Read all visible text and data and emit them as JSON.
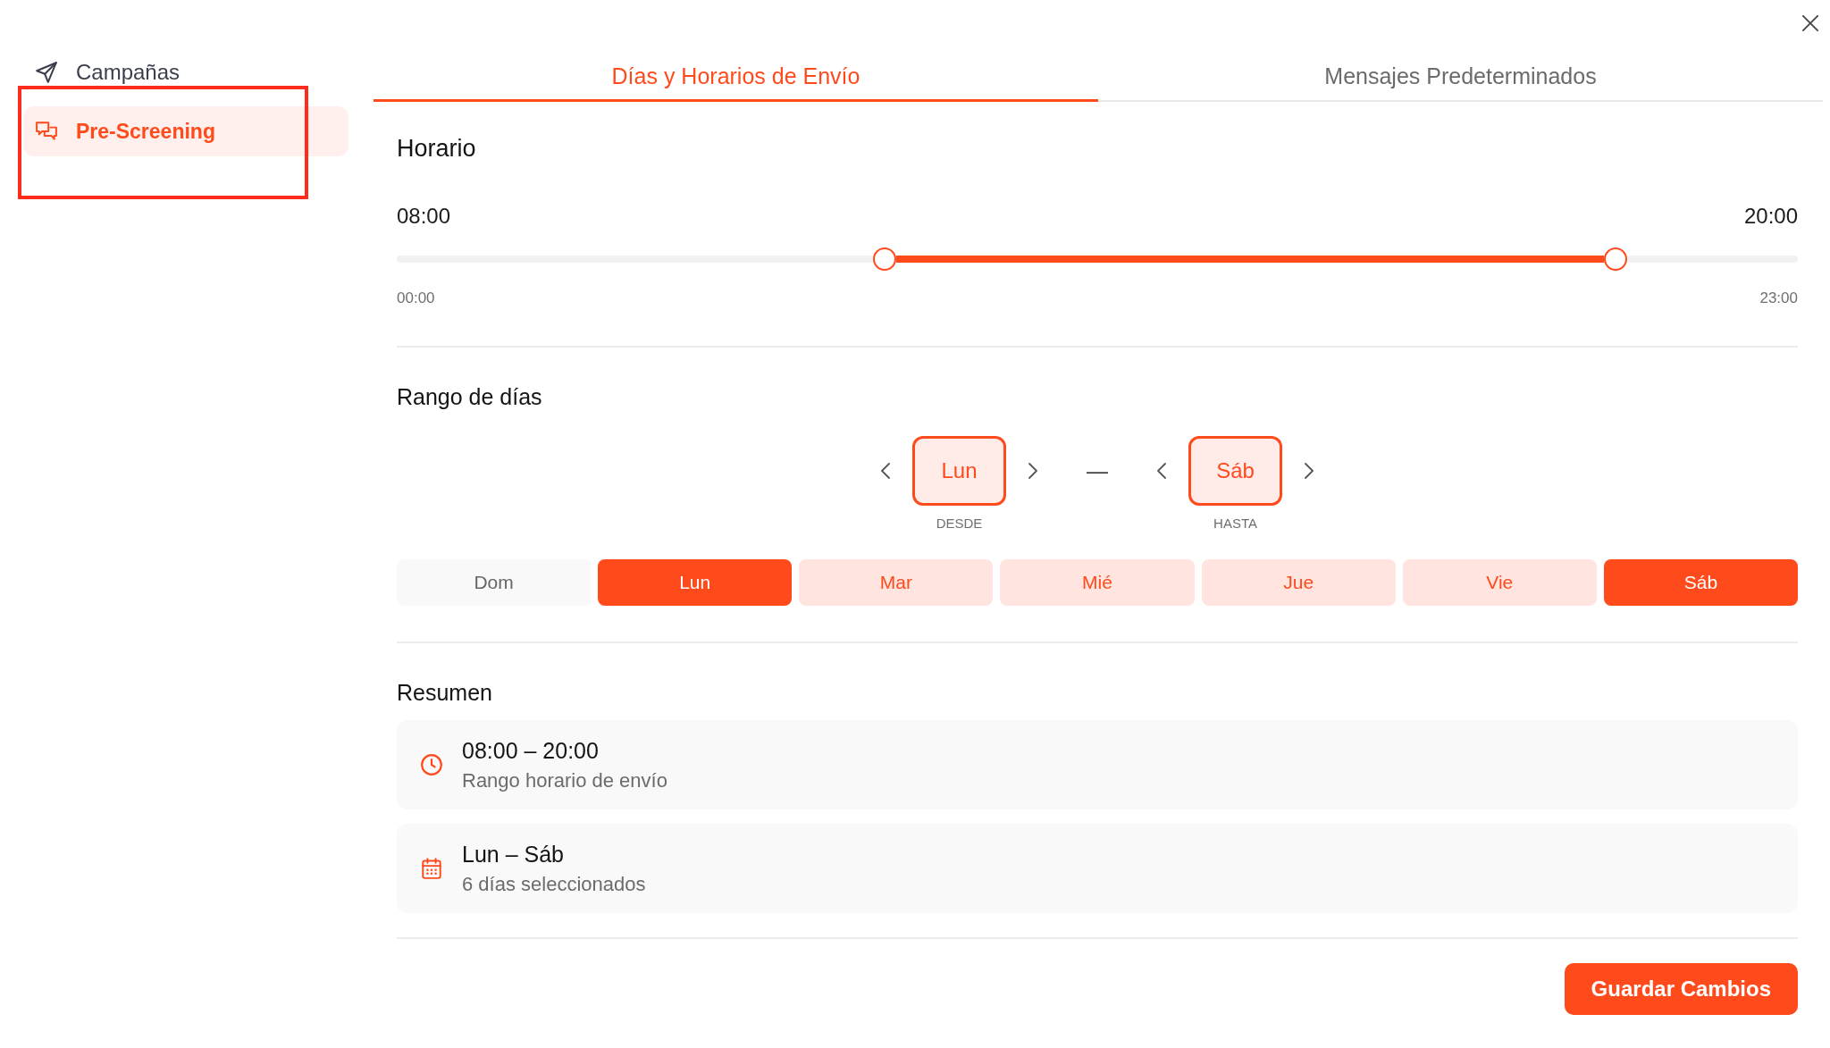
{
  "sidebar": {
    "items": [
      {
        "label": "Campañas",
        "selected": false,
        "highlighted": false
      },
      {
        "label": "Pre-Screening",
        "selected": true,
        "highlighted": true
      }
    ]
  },
  "tabs": [
    {
      "label": "Días y Horarios de Envío",
      "selected": true
    },
    {
      "label": "Mensajes Predeterminados",
      "selected": false
    }
  ],
  "schedule": {
    "title": "Horario",
    "start_time": "08:00",
    "end_time": "20:00",
    "slider": {
      "thumbs": [
        {
          "level": 0.348
        },
        {
          "level": 0.87
        }
      ],
      "min_label": "00:00",
      "max_label": "23:00"
    }
  },
  "day_range": {
    "title": "Rango de días",
    "from": {
      "day": "Lun",
      "label": "DESDE"
    },
    "separator": "—",
    "to": {
      "day": "Sáb",
      "label": "HASTA"
    },
    "days": [
      {
        "label": "Dom",
        "selected": false,
        "endpoint": false
      },
      {
        "label": "Lun",
        "selected": true,
        "endpoint": true
      },
      {
        "label": "Mar",
        "selected": true,
        "endpoint": false
      },
      {
        "label": "Mié",
        "selected": true,
        "endpoint": false
      },
      {
        "label": "Jue",
        "selected": true,
        "endpoint": false
      },
      {
        "label": "Vie",
        "selected": true,
        "endpoint": false
      },
      {
        "label": "Sáb",
        "selected": true,
        "endpoint": true
      }
    ]
  },
  "summary": {
    "title": "Resumen",
    "items": [
      {
        "title": "08:00 – 20:00",
        "subtitle": "Rango horario de envío"
      },
      {
        "title": "Lun – Sáb",
        "subtitle": "6 días seleccionados"
      }
    ]
  },
  "save_button": {
    "label": "Guardar Cambios"
  }
}
